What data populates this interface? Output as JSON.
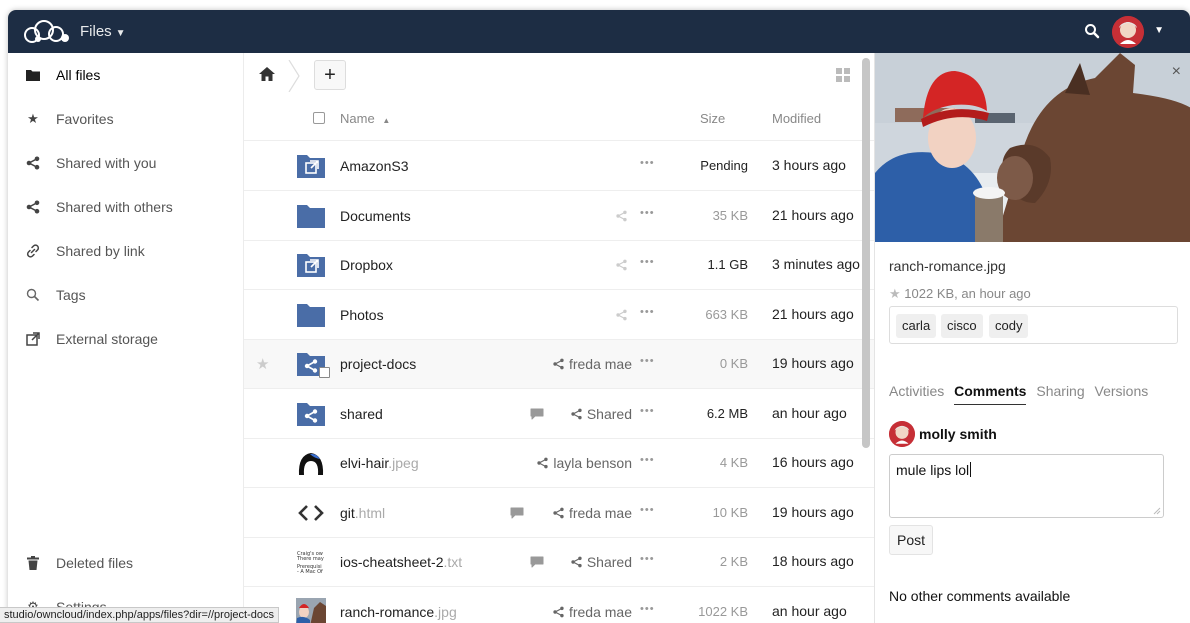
{
  "header": {
    "app_name": "Files",
    "brand_color": "#1d2d44",
    "search_icon": "search-icon"
  },
  "sidebar": {
    "items": [
      {
        "label": "All files",
        "icon": "folder-icon",
        "active": true
      },
      {
        "label": "Favorites",
        "icon": "star-icon"
      },
      {
        "label": "Shared with you",
        "icon": "share-icon"
      },
      {
        "label": "Shared with others",
        "icon": "share-icon"
      },
      {
        "label": "Shared by link",
        "icon": "link-icon"
      },
      {
        "label": "Tags",
        "icon": "tag-search-icon"
      },
      {
        "label": "External storage",
        "icon": "external-storage-icon"
      }
    ],
    "deleted": "Deleted files",
    "settings": "Settings"
  },
  "toolbar": {
    "add_label": "+"
  },
  "table": {
    "headers": {
      "name": "Name",
      "sort": "▲",
      "size": "Size",
      "modified": "Modified"
    },
    "rows": [
      {
        "name": "AmazonS3",
        "ext": "",
        "type": "external-folder",
        "share": "",
        "comment": false,
        "size": "Pending",
        "size_dark": true,
        "modified": "3 hours ago"
      },
      {
        "name": "Documents",
        "ext": "",
        "type": "folder",
        "share": "",
        "share_muted": true,
        "comment": false,
        "size": "35 KB",
        "modified": "21 hours ago"
      },
      {
        "name": "Dropbox",
        "ext": "",
        "type": "external-folder",
        "share": "",
        "share_muted": true,
        "comment": false,
        "size": "1.1 GB",
        "size_dark": true,
        "modified": "3 minutes ago"
      },
      {
        "name": "Photos",
        "ext": "",
        "type": "folder",
        "share": "",
        "share_muted": true,
        "comment": false,
        "size": "663 KB",
        "modified": "21 hours ago"
      },
      {
        "name": "project-docs",
        "ext": "",
        "type": "shared-folder",
        "share": "freda mae",
        "comment": false,
        "size": "0 KB",
        "modified": "19 hours ago",
        "selected": true
      },
      {
        "name": "shared",
        "ext": "",
        "type": "shared-folder",
        "share": "Shared",
        "comment": true,
        "size": "6.2 MB",
        "size_dark": true,
        "modified": "an hour ago"
      },
      {
        "name": "elvi-hair",
        "ext": ".jpeg",
        "type": "image-hair",
        "share": "layla benson",
        "comment": false,
        "size": "4 KB",
        "modified": "16 hours ago"
      },
      {
        "name": "git",
        "ext": ".html",
        "type": "code",
        "share": "freda mae",
        "comment": true,
        "size": "10 KB",
        "modified": "19 hours ago"
      },
      {
        "name": "ios-cheatsheet-2",
        "ext": ".txt",
        "type": "text",
        "share": "Shared",
        "comment": true,
        "size": "2 KB",
        "modified": "18 hours ago"
      },
      {
        "name": "ranch-romance",
        "ext": ".jpg",
        "type": "image-ranch",
        "share": "freda mae",
        "comment": false,
        "size": "1022 KB",
        "modified": "an hour ago"
      }
    ],
    "more": "•••"
  },
  "details": {
    "filename": "ranch-romance.jpg",
    "meta": "1022 KB, an hour ago",
    "tags": [
      "carla",
      "cisco",
      "cody"
    ],
    "tabs": [
      "Activities",
      "Comments",
      "Sharing",
      "Versions"
    ],
    "active_tab": "Comments",
    "comment_user": "molly smith",
    "comment_draft": "mule lips lol",
    "post_label": "Post",
    "no_comments": "No other comments available",
    "close": "×"
  },
  "statusbar": {
    "url": "studio/owncloud/index.php/apps/files?dir=//project-docs"
  }
}
